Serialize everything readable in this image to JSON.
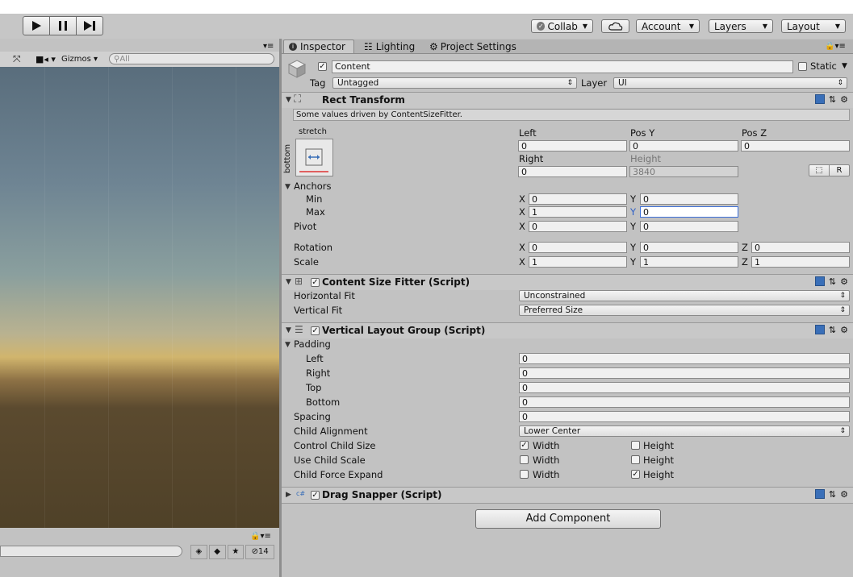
{
  "toolbar": {
    "collab": "Collab",
    "account": "Account",
    "layers": "Layers",
    "layout": "Layout"
  },
  "scene": {
    "gizmos": "Gizmos",
    "search_placeholder": "All",
    "hidden_count": "14"
  },
  "tabs": [
    {
      "label": "Inspector"
    },
    {
      "label": "Lighting"
    },
    {
      "label": "Project Settings"
    }
  ],
  "object": {
    "name": "Content",
    "static_label": "Static",
    "tag_label": "Tag",
    "tag_value": "Untagged",
    "layer_label": "Layer",
    "layer_value": "UI"
  },
  "rect_transform": {
    "title": "Rect Transform",
    "note": "Some values driven by ContentSizeFitter.",
    "anchor_preset": "stretch",
    "anchor_side": "bottom",
    "headers": {
      "left": "Left",
      "pos_y": "Pos Y",
      "pos_z": "Pos Z",
      "right": "Right",
      "height": "Height"
    },
    "left": "0",
    "pos_y": "0",
    "pos_z": "0",
    "right": "0",
    "height": "3840",
    "raw_button": "R",
    "anchors_label": "Anchors",
    "min_label": "Min",
    "max_label": "Max",
    "pivot_label": "Pivot",
    "rotation_label": "Rotation",
    "scale_label": "Scale",
    "min_x": "0",
    "min_y": "0",
    "max_x": "1",
    "max_y": "0",
    "pivot_x": "0",
    "pivot_y": "0",
    "rot_x": "0",
    "rot_y": "0",
    "rot_z": "0",
    "scale_x": "1",
    "scale_y": "1",
    "scale_z": "1",
    "axis_x": "X",
    "axis_y": "Y",
    "axis_z": "Z"
  },
  "content_size_fitter": {
    "title": "Content Size Fitter (Script)",
    "horizontal_label": "Horizontal Fit",
    "horizontal_value": "Unconstrained",
    "vertical_label": "Vertical Fit",
    "vertical_value": "Preferred Size"
  },
  "vertical_layout": {
    "title": "Vertical Layout Group (Script)",
    "padding_label": "Padding",
    "left_label": "Left",
    "left": "0",
    "right_label": "Right",
    "right": "0",
    "top_label": "Top",
    "top": "0",
    "bottom_label": "Bottom",
    "bottom": "0",
    "spacing_label": "Spacing",
    "spacing": "0",
    "alignment_label": "Child Alignment",
    "alignment": "Lower Center",
    "control_label": "Control Child Size",
    "scale_label": "Use Child Scale",
    "expand_label": "Child Force Expand",
    "width": "Width",
    "height": "Height"
  },
  "drag_snapper": {
    "title": "Drag Snapper (Script)"
  },
  "add_component": "Add Component"
}
